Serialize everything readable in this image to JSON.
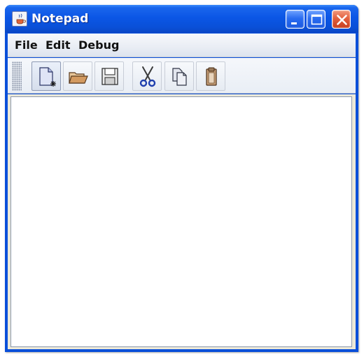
{
  "window": {
    "title": "Notepad"
  },
  "titlebar": {
    "buttons": [
      "minimize",
      "maximize",
      "close"
    ]
  },
  "menubar": {
    "items": [
      "File",
      "Edit",
      "Debug"
    ]
  },
  "toolbar": {
    "tools": [
      {
        "name": "new",
        "icon": "new-document-icon"
      },
      {
        "name": "open",
        "icon": "open-folder-icon"
      },
      {
        "name": "save",
        "icon": "save-disk-icon"
      },
      {
        "name": "cut",
        "icon": "scissors-icon"
      },
      {
        "name": "copy",
        "icon": "copy-icon"
      },
      {
        "name": "paste",
        "icon": "clipboard-icon"
      }
    ]
  },
  "editor": {
    "text": ""
  },
  "colors": {
    "titlebar": "#0a50d8",
    "close": "#e2603e",
    "menubar": "#e9edf4"
  }
}
